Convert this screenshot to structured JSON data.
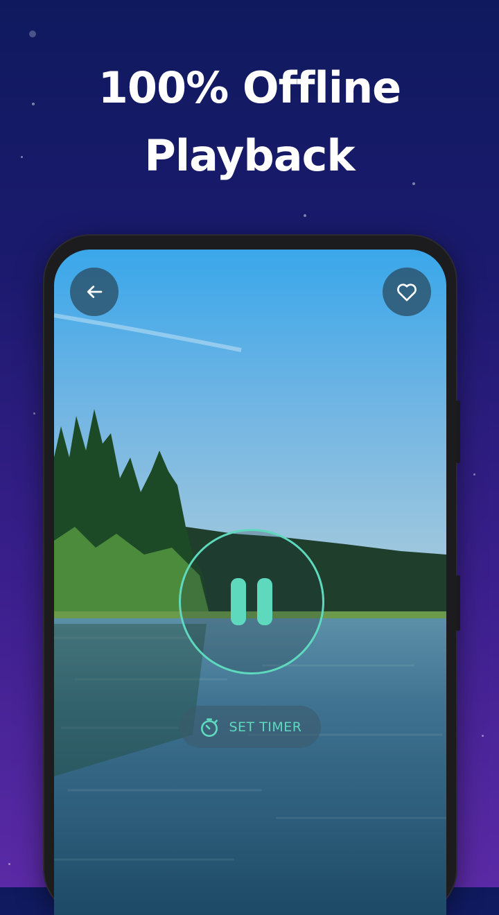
{
  "headline": {
    "line1": "100% Offline",
    "line2": "Playback"
  },
  "player": {
    "back_icon": "arrow-left-icon",
    "favorite_icon": "heart-outline-icon",
    "pause_icon": "pause-icon",
    "timer_icon": "stopwatch-icon",
    "timer_label": "SET TIMER",
    "state": "playing"
  },
  "colors": {
    "accent": "#5fd9be",
    "background_top": "#0f1a5e",
    "background_bottom": "#5b2aa6"
  }
}
